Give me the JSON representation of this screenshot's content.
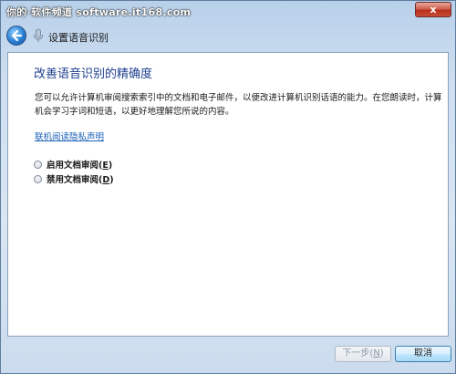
{
  "titlebar": {
    "watermark": "你的·软件频道 software.it168.com",
    "close_label": "x"
  },
  "navbar": {
    "title": "设置语音识别"
  },
  "main": {
    "heading": "改善语音识别的精确度",
    "description": "您可以允许计算机审阅搜索索引中的文档和电子邮件，以便改进计算机识别话语的能力。在您朗读时，计算机会学习字词和短语，以更好地理解您所说的内容。",
    "privacy_link": "联机阅读隐私声明",
    "options": [
      {
        "label_main": "启用文档审阅(",
        "accel": "E",
        "label_end": ")"
      },
      {
        "label_main": "禁用文档审阅(",
        "accel": "D",
        "label_end": ")"
      }
    ]
  },
  "footer": {
    "next_main": "下一步(",
    "next_accel": "N",
    "next_end": ")",
    "cancel_label": "取消"
  },
  "colors": {
    "heading": "#1f3f8f",
    "link": "#1a5fb8",
    "close": "#c9402a"
  }
}
